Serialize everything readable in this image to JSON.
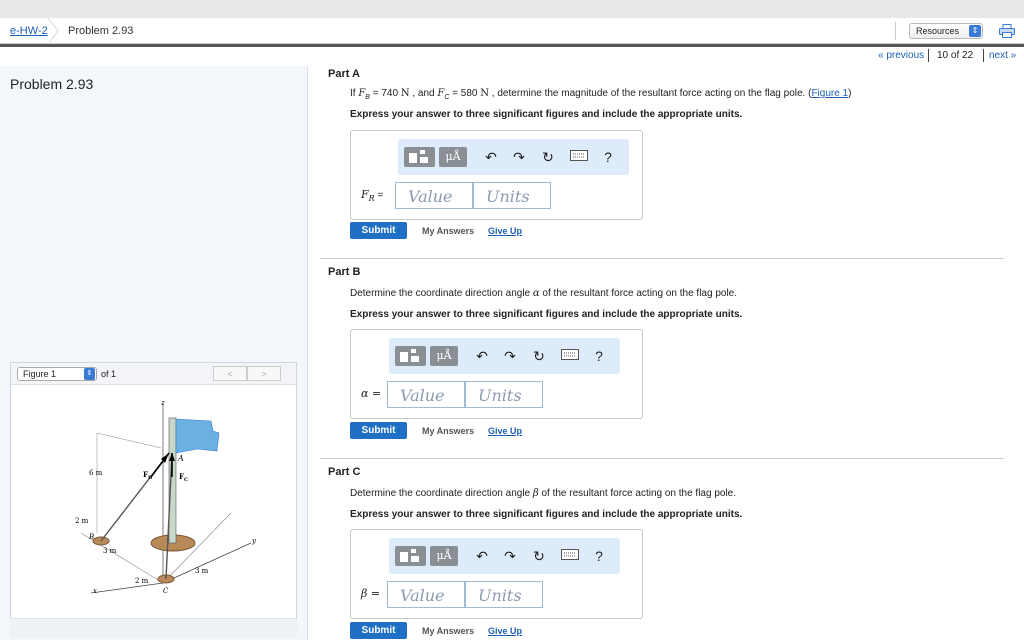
{
  "breadcrumb": {
    "link": "e-HW-2",
    "current": "Problem 2.93"
  },
  "resources": {
    "label": "Resources"
  },
  "nav": {
    "previous": "« previous",
    "count": "10 of 22",
    "next": "next »"
  },
  "left": {
    "problem_title": "Problem 2.93"
  },
  "figure": {
    "select": "Figure 1",
    "of": "of 1",
    "prev": "<",
    "next": ">",
    "labels": {
      "z": "z",
      "A": "A",
      "FB": "F",
      "FBsub": "B",
      "FC": "F",
      "FCsub": "C",
      "six_m": "6 m",
      "two_m_a": "2 m",
      "B": "B",
      "three_m_a": "3 m",
      "two_m_b": "2 m",
      "three_m_b": "3 m",
      "x": "x",
      "y": "y",
      "C": "C"
    }
  },
  "toolbar": {
    "mu": "μÅ",
    "undo": "↶",
    "redo": "↷",
    "reset": "↻",
    "help": "?"
  },
  "parts": [
    {
      "title": "Part A",
      "q_prefix": "If ",
      "q_var1": "F",
      "q_sub1": "B",
      "q_mid1": " = 740 ",
      "q_unit1": "N",
      "q_mid2": " , and ",
      "q_var2": "F",
      "q_sub2": "C",
      "q_mid3": " = 580 ",
      "q_unit2": "N",
      "q_rest": " , determine the magnitude of the resultant force acting on the flag pole. (",
      "q_link": "Figure 1",
      "q_end": ")",
      "instruction": "Express your answer to three significant figures and include the appropriate units.",
      "label_var": "F",
      "label_sub": "R",
      "label_eq": " =",
      "value_placeholder": "Value",
      "units_placeholder": "Units"
    },
    {
      "title": "Part B",
      "q_prefix": "Determine the coordinate direction angle ",
      "q_var": "α",
      "q_rest": " of the resultant force acting on the flag pole.",
      "instruction": "Express your answer to three significant figures and include the appropriate units.",
      "label": "α =",
      "value_placeholder": "Value",
      "units_placeholder": "Units"
    },
    {
      "title": "Part C",
      "q_prefix": "Determine the coordinate direction angle ",
      "q_var": "β",
      "q_rest": " of the resultant force acting on the flag pole.",
      "instruction": "Express your answer to three significant figures and include the appropriate units.",
      "label": "β =",
      "value_placeholder": "Value",
      "units_placeholder": "Units"
    }
  ],
  "buttons": {
    "submit": "Submit",
    "my_answers": "My Answers",
    "give_up": "Give Up"
  }
}
